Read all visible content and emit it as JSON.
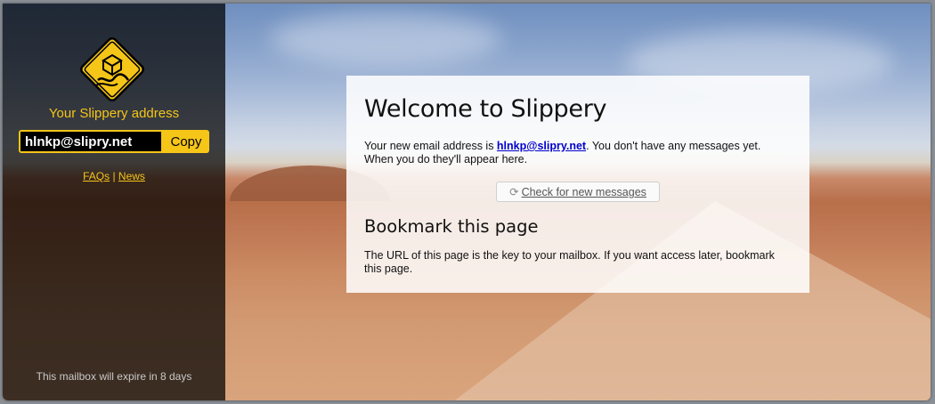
{
  "sidebar": {
    "logo_icon": "slippery-road-sign-icon",
    "address_title": "Your Slippery address",
    "address_value": "hlnkp@slipry.net",
    "copy_label": "Copy",
    "link_faqs": "FAQs",
    "link_separator": "|",
    "link_news": "News",
    "expire_text": "This mailbox will expire in 8 days"
  },
  "main": {
    "title": "Welcome to Slippery",
    "intro_prefix": "Your new email address is ",
    "intro_address": "hlnkp@slipry.net",
    "intro_suffix": ". You don't have any messages yet. When you do they'll appear here.",
    "check_icon": "refresh-icon",
    "check_label": "Check for new messages",
    "bookmark_title": "Bookmark this page",
    "bookmark_text": "The URL of this page is the key to your mailbox. If you want access later, bookmark this page."
  },
  "colors": {
    "accent": "#f5c518",
    "sidebar_bg": "#000000",
    "link": "#0000cc"
  }
}
